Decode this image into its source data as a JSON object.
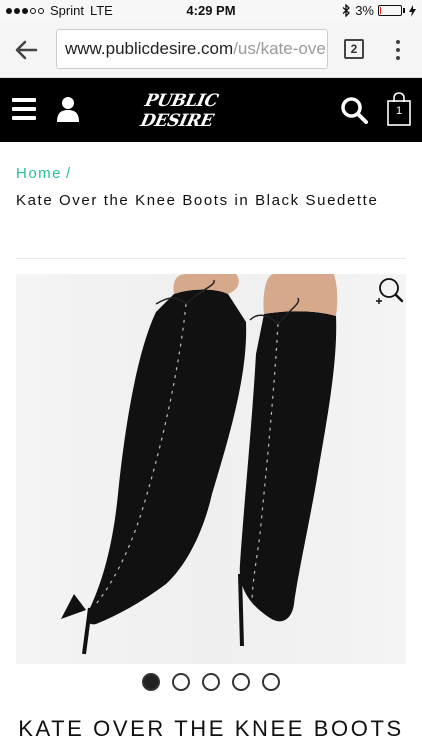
{
  "status_bar": {
    "carrier": "Sprint",
    "network": "LTE",
    "time": "4:29 PM",
    "bluetooth_icon": "bluetooth-icon",
    "battery_percent": "3%",
    "battery_level": 0.03
  },
  "browser": {
    "url_domain": "www.publicdesire.com",
    "url_path": "/us/kate-ove",
    "tab_count": "2"
  },
  "site_header": {
    "logo_text": "PUBLIC DESIRE",
    "bag_count": "1"
  },
  "breadcrumb": {
    "home": "Home",
    "separator": "/"
  },
  "product": {
    "title": "Kate Over the Knee Boots in Black Suedette",
    "heading": "KATE OVER THE KNEE BOOTS"
  },
  "carousel": {
    "count": 5,
    "active_index": 0
  },
  "colors": {
    "accent": "#2bbf9a",
    "header_bg": "#000000"
  }
}
